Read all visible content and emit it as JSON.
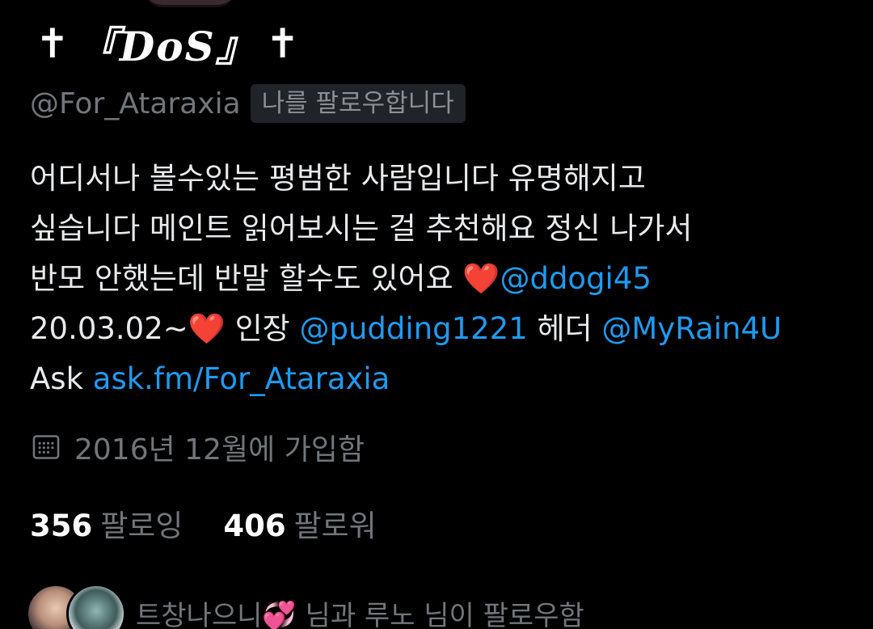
{
  "profile": {
    "display_name_prefix": "✝",
    "display_name_core": "『DoS』",
    "display_name_suffix": "✝",
    "handle": "@For_Ataraxia",
    "follows_you_badge": "나를 팔로우합니다"
  },
  "bio": {
    "line1": "어디서나 볼수있는 평범한 사람입니다 유명해지고",
    "line2": "싶습니다 메인트 읽어보시는 걸 추천해요 정신 나가서",
    "line3_text": "반모 안했는데 반말 할수도 있어요 ",
    "line3_heart": "❤️",
    "line3_link": "@ddogi45",
    "line4_text1": "20.03.02~",
    "line4_heart": "❤️",
    "line4_text2": " 인장 ",
    "line4_link1": "@pudding1221",
    "line4_text3": " 헤더 ",
    "line4_link2": "@MyRain4U",
    "line5_text": "Ask ",
    "line5_link": "ask.fm/For_Ataraxia"
  },
  "joined": {
    "icon": "calendar-icon",
    "text": "2016년 12월에 가입함"
  },
  "stats": {
    "following_count": "356",
    "following_label": "팔로잉",
    "followers_count": "406",
    "followers_label": "팔로워"
  },
  "followed_by": {
    "text": "트창나으니💞 님과 루노 님이 팔로우함"
  },
  "colors": {
    "background": "#000000",
    "link": "#1d9bf0",
    "muted": "#71767b",
    "heart": "#f4212e"
  }
}
